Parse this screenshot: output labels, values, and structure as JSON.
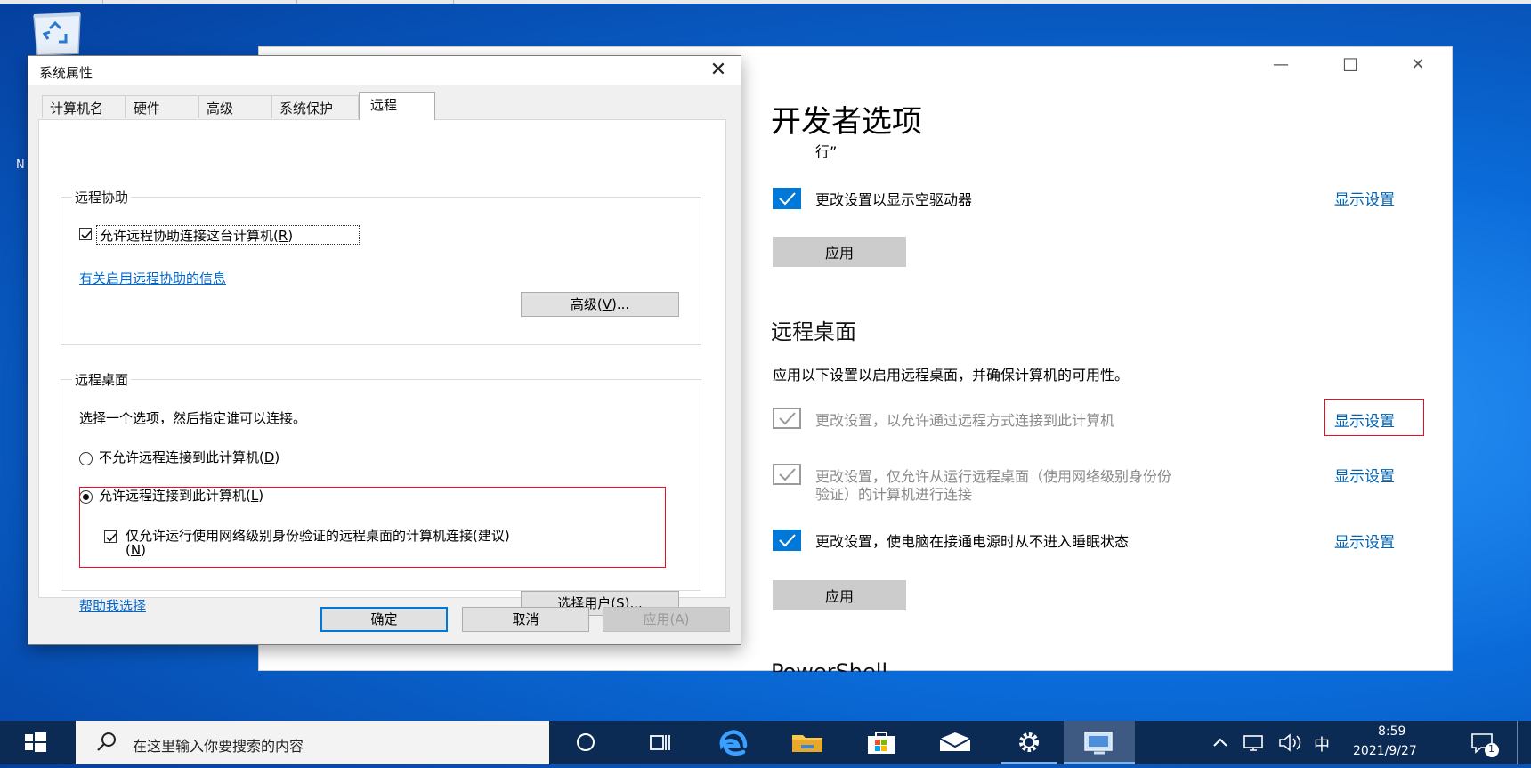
{
  "dialog": {
    "title": "系统属性",
    "close_glyph": "✕",
    "tabs": [
      "计算机名",
      "硬件",
      "高级",
      "系统保护",
      "远程"
    ],
    "remote_assistance": {
      "legend": "远程协助",
      "allow_label": "允许远程协助连接这台计算机(",
      "allow_key": "R",
      "allow_suffix": ")",
      "info_link": "有关启用远程协助的信息",
      "advanced_label": "高级(",
      "advanced_key": "V",
      "advanced_suffix": ")..."
    },
    "remote_desktop": {
      "legend": "远程桌面",
      "prompt": "选择一个选项，然后指定谁可以连接。",
      "deny_label": "不允许远程连接到此计算机(",
      "deny_key": "D",
      "deny_suffix": ")",
      "allow_label": "允许远程连接到此计算机(",
      "allow_key": "L",
      "allow_suffix": ")",
      "nla_label": "仅允许运行使用网络级别身份验证的远程桌面的计算机连接(建议)",
      "nla_key_prefix": "(",
      "nla_key": "N",
      "nla_key_suffix": ")",
      "help_link": "帮助我选择",
      "select_users_label": "选择用户(",
      "select_users_key": "S",
      "select_users_suffix": ")..."
    },
    "buttons": {
      "ok": "确定",
      "cancel": "取消",
      "apply": "应用(A)"
    }
  },
  "settings": {
    "title": "开发者选项",
    "subtitle_fragment": "行”",
    "minimize_glyph": "—",
    "maximize_glyph": "☐",
    "close_glyph": "✕",
    "explorer_row": {
      "label": "更改设置以显示空驱动器",
      "link": "显示设置"
    },
    "apply_label": "应用",
    "remote_section": {
      "heading": "远程桌面",
      "description": "应用以下设置以启用远程桌面，并确保计算机的可用性。",
      "row1": {
        "label": "更改设置，以允许通过远程方式连接到此计算机",
        "link": "显示设置"
      },
      "row2": {
        "label_line1": "更改设置，仅允许从运行远程桌面（使用网络级别身份份",
        "label_line2": "验证）的计算机进行连接",
        "link": "显示设置"
      },
      "row3": {
        "label": "更改设置，使电脑在接通电源时从不进入睡眠状态",
        "link": "显示设置"
      }
    },
    "apply_label_2": "应用",
    "next_section_cut": "PowerShell"
  },
  "taskbar": {
    "search_placeholder": "在这里输入你要搜索的内容",
    "tray": {
      "ime": "中",
      "time": "8:59",
      "date": "2021/9/27",
      "notification_count": "1"
    }
  },
  "desktop": {
    "edge_label": "N"
  },
  "colors": {
    "accent": "#0078d7",
    "link": "#0063b1",
    "highlight_box": "#e81123",
    "taskbar": "#0b2a54"
  }
}
